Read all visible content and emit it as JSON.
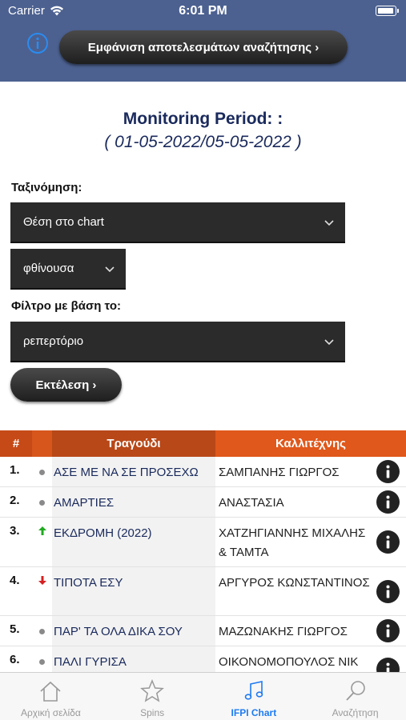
{
  "status_bar": {
    "carrier": "Carrier",
    "time": "6:01 PM"
  },
  "header": {
    "search_results_label": "Εμφάνιση αποτελεσμάτων αναζήτησης ›"
  },
  "period": {
    "title": "Monitoring Period: :",
    "range": "( 01-05-2022/05-05-2022 )"
  },
  "sort": {
    "label": "Ταξινόμηση:",
    "field_value": "Θέση στο chart",
    "order_value": "φθίνουσα"
  },
  "filter": {
    "label": "Φίλτρο με βάση το:",
    "value": "ρεπερτόριο"
  },
  "run_label": "Εκτέλεση ›",
  "table": {
    "headers": {
      "num": "#",
      "song": "Τραγούδι",
      "artist": "Καλλιτέχνης"
    },
    "rows": [
      {
        "num": "1.",
        "trend": "same",
        "song": "ΑΣΕ ΜΕ ΝΑ ΣΕ ΠΡΟΣΕΧΩ",
        "artist": "ΣΑΜΠΑΝΗΣ ΓΙΩΡΓΟΣ"
      },
      {
        "num": "2.",
        "trend": "same",
        "song": "ΑΜΑΡΤΙΕΣ",
        "artist": "ΑΝΑΣΤΑΣΙΑ"
      },
      {
        "num": "3.",
        "trend": "up",
        "song": "ΕΚΔΡΟΜΗ (2022)",
        "artist": "ΧΑΤΖΗΓΙΑΝΝΗΣ ΜΙΧΑΛΗΣ & ΤΑΜΤΑ"
      },
      {
        "num": "4.",
        "trend": "down",
        "song": "ΤΙΠΟΤΑ ΕΣΥ",
        "artist": "ΑΡΓΥΡΟΣ ΚΩΝΣΤΑΝΤΙΝΟΣ"
      },
      {
        "num": "5.",
        "trend": "same",
        "song": "ΠΑΡ' ΤΑ ΟΛΑ ΔΙΚΑ ΣΟΥ",
        "artist": "ΜΑΖΩΝΑΚΗΣ ΓΙΩΡΓΟΣ"
      },
      {
        "num": "6.",
        "trend": "same",
        "song": "ΠΑΛΙ ΓΥΡΙΣΑ",
        "artist": "ΟΙΚΟΝΟΜΟΠΟΥΛΟΣ ΝΙΚ"
      }
    ]
  },
  "tabs": [
    {
      "label": "Αρχική σελίδα",
      "icon": "home-icon"
    },
    {
      "label": "Spins",
      "icon": "star-icon"
    },
    {
      "label": "IFPI Chart",
      "icon": "music-note-icon",
      "active": true
    },
    {
      "label": "Αναζήτηση",
      "icon": "search-icon"
    }
  ],
  "colors": {
    "header_bg": "#4c6190",
    "accent_orange": "#e0581b",
    "active_tab": "#1e7bf2",
    "title_navy": "#1a2a5c"
  }
}
